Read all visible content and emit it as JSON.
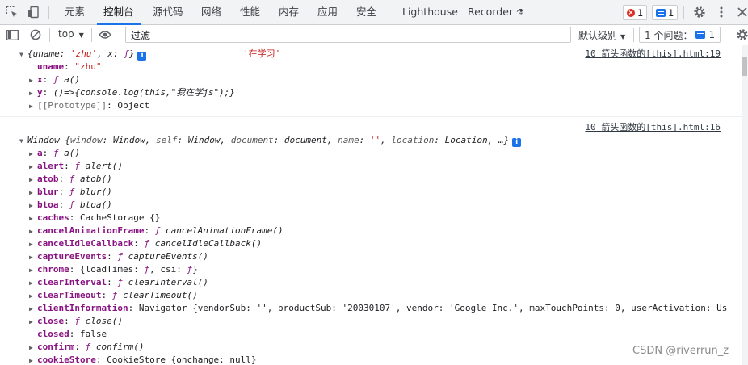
{
  "tabs": {
    "items": [
      {
        "label": "元素"
      },
      {
        "label": "控制台"
      },
      {
        "label": "源代码"
      },
      {
        "label": "网络"
      },
      {
        "label": "性能"
      },
      {
        "label": "内存"
      },
      {
        "label": "应用"
      },
      {
        "label": "安全"
      },
      {
        "label": "Lighthouse"
      },
      {
        "label": "Recorder"
      }
    ],
    "active_index": 1,
    "error_count": "1",
    "message_count": "1"
  },
  "toolbar": {
    "context": "top",
    "filter_value": "过滤",
    "levels_label": "默认级别",
    "issues_label": "1 个问题：",
    "issues_count": "1"
  },
  "console": {
    "entry1": {
      "source": "10 箭头函数的[this].html:19",
      "preview_prefix": "{uname: ",
      "preview_uname": "'zhu'",
      "preview_mid": ", x: ",
      "preview_f": "ƒ",
      "preview_end": "}",
      "log_string": "'在学习'",
      "props": [
        {
          "key": "uname",
          "value": "\"zhu\""
        },
        {
          "key": "x",
          "value": "ƒ a()"
        },
        {
          "key": "y",
          "value": "()=>{console.log(this,\"我在学js\");}"
        },
        {
          "key": "[[Prototype]]",
          "value": "Object"
        }
      ]
    },
    "entry2": {
      "source": "10 箭头函数的[this].html:16",
      "preview": "Window {window: Window, self: Window, document: document, name: '', location: Location, …}",
      "props": [
        {
          "key": "a",
          "value": "ƒ a()"
        },
        {
          "key": "alert",
          "value": "ƒ alert()"
        },
        {
          "key": "atob",
          "value": "ƒ atob()"
        },
        {
          "key": "blur",
          "value": "ƒ blur()"
        },
        {
          "key": "btoa",
          "value": "ƒ btoa()"
        },
        {
          "key": "caches",
          "value": "CacheStorage {}"
        },
        {
          "key": "cancelAnimationFrame",
          "value": "ƒ cancelAnimationFrame()"
        },
        {
          "key": "cancelIdleCallback",
          "value": "ƒ cancelIdleCallback()"
        },
        {
          "key": "captureEvents",
          "value": "ƒ captureEvents()"
        },
        {
          "key": "chrome",
          "value": "{loadTimes: ƒ, csi: ƒ}"
        },
        {
          "key": "clearInterval",
          "value": "ƒ clearInterval()"
        },
        {
          "key": "clearTimeout",
          "value": "ƒ clearTimeout()"
        },
        {
          "key": "clientInformation",
          "value": "Navigator {vendorSub: '', productSub: '20030107', vendor: 'Google Inc.', maxTouchPoints: 0, userActivation: Us"
        },
        {
          "key": "close",
          "value": "ƒ close()"
        },
        {
          "key": "closed",
          "value": "false"
        },
        {
          "key": "confirm",
          "value": "ƒ confirm()"
        },
        {
          "key": "cookieStore",
          "value": "CookieStore {onchange: null}"
        }
      ]
    }
  },
  "watermark": "CSDN @riverrun_z"
}
